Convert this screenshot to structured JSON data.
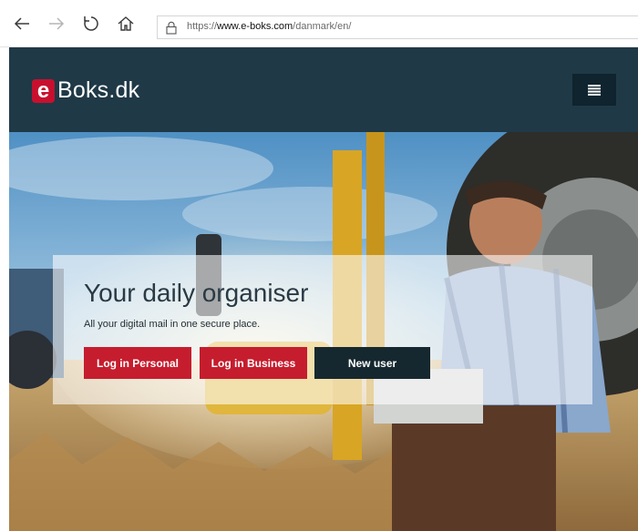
{
  "browser": {
    "url_prefix": "https://",
    "url_domain": "www.e-boks.com",
    "url_path": "/danmark/en/"
  },
  "header": {
    "logo_mark": "e",
    "logo_text": "Boks.dk"
  },
  "hero": {
    "headline": "Your daily organiser",
    "subline": "All your digital mail in one secure place.",
    "buttons": {
      "personal": "Log in Personal",
      "business": "Log in Business",
      "new_user": "New user"
    }
  },
  "colors": {
    "header_bg": "#1f3947",
    "brand_red": "#c8102e",
    "button_red": "#c51d2e",
    "button_dark": "#16282f"
  }
}
